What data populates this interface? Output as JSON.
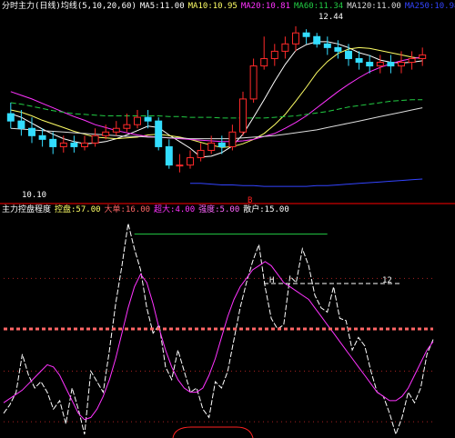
{
  "colors": {
    "background": "#000000",
    "divider": "#ff0000",
    "up_candle": "#ff2a2a",
    "down_candle": "#33ddff",
    "ma_white": "#ffffff",
    "ma_yellow": "#ffff66",
    "ma_magenta": "#ff33ff",
    "ma_green": "#22cc44",
    "ma_blue": "#3344ff",
    "dashed_red": "#ff6666"
  },
  "top_panel": {
    "header": [
      {
        "text": "分时主力(日线)均线(5,10,20,60)",
        "color": "#ffffff"
      },
      {
        "text": "MA5:11.00",
        "color": "#ffffff"
      },
      {
        "text": "MA10:10.95",
        "color": "#ffff66"
      },
      {
        "text": "MA20:10.81",
        "color": "#ff33ff"
      },
      {
        "text": "MA60:11.34",
        "color": "#22cc44"
      },
      {
        "text": "MA120:11.00",
        "color": "#dddddd"
      },
      {
        "text": "MA250:10.98",
        "color": "#3344ff"
      }
    ],
    "high_label": "12.44",
    "low_label": "10.10",
    "red_marker": "B"
  },
  "bottom_panel": {
    "header": [
      {
        "text": "主力控盘程度",
        "color": "#ffffff"
      },
      {
        "text": "控盘:57.00",
        "color": "#ffff66"
      },
      {
        "text": "大单:16.00",
        "color": "#ff6666"
      },
      {
        "text": "超大:4.00",
        "color": "#ff33ff"
      },
      {
        "text": "强度:5.00",
        "color": "#ff66ff"
      },
      {
        "text": "散户:15.00",
        "color": "#ffffff"
      }
    ],
    "marker_12": "12",
    "marker_h": "H"
  },
  "chart_data": [
    {
      "type": "candlestick",
      "note": "price panel with moving averages",
      "x": [
        1,
        2,
        3,
        4,
        5,
        6,
        7,
        8,
        9,
        10,
        11,
        12,
        13,
        14,
        15,
        16,
        17,
        18,
        19,
        20,
        21,
        22,
        23,
        24,
        25,
        26,
        27,
        28,
        29,
        30,
        31,
        32,
        33,
        34,
        35,
        36,
        37,
        38,
        39,
        40
      ],
      "open": [
        11.25,
        11.15,
        11.05,
        10.95,
        10.9,
        10.8,
        10.85,
        10.8,
        10.85,
        10.95,
        11.0,
        11.05,
        11.1,
        11.2,
        11.15,
        10.8,
        10.55,
        10.55,
        10.65,
        10.75,
        10.85,
        10.8,
        11.0,
        11.45,
        11.9,
        12.0,
        12.1,
        12.2,
        12.35,
        12.3,
        12.2,
        12.15,
        12.1,
        12.0,
        11.95,
        11.9,
        11.95,
        11.9,
        11.95,
        12.0
      ],
      "close": [
        11.15,
        11.05,
        10.95,
        10.9,
        10.8,
        10.85,
        10.8,
        10.85,
        10.95,
        11.0,
        11.05,
        11.1,
        11.2,
        11.15,
        10.8,
        10.55,
        10.55,
        10.65,
        10.75,
        10.85,
        10.8,
        11.0,
        11.45,
        11.9,
        12.0,
        12.1,
        12.2,
        12.35,
        12.3,
        12.2,
        12.15,
        12.1,
        12.0,
        11.95,
        11.9,
        11.95,
        11.9,
        11.95,
        12.0,
        12.05
      ],
      "high": [
        11.4,
        11.3,
        11.2,
        11.05,
        11.0,
        10.95,
        10.95,
        10.95,
        11.05,
        11.1,
        11.15,
        11.25,
        11.3,
        11.3,
        11.2,
        10.9,
        10.7,
        10.75,
        10.85,
        10.95,
        10.95,
        11.1,
        11.55,
        12.0,
        12.3,
        12.2,
        12.3,
        12.44,
        12.4,
        12.35,
        12.3,
        12.25,
        12.2,
        12.1,
        12.05,
        12.05,
        12.05,
        12.1,
        12.1,
        12.15
      ],
      "low": [
        11.05,
        10.95,
        10.85,
        10.8,
        10.7,
        10.72,
        10.72,
        10.75,
        10.8,
        10.9,
        10.95,
        11.0,
        11.05,
        11.05,
        10.75,
        10.5,
        10.45,
        10.5,
        10.6,
        10.7,
        10.7,
        10.75,
        10.95,
        11.4,
        11.85,
        11.9,
        12.0,
        12.1,
        12.2,
        12.15,
        12.05,
        12.0,
        11.9,
        11.85,
        11.8,
        11.8,
        11.8,
        11.8,
        11.85,
        11.9
      ],
      "ylim": [
        10.1,
        12.6
      ],
      "series": [
        {
          "name": "MA5",
          "color": "#ffffff",
          "values": [
            11.25,
            11.2,
            11.12,
            11.04,
            10.97,
            10.91,
            10.87,
            10.84,
            10.85,
            10.87,
            10.91,
            10.96,
            11.02,
            11.08,
            11.06,
            10.96,
            10.87,
            10.78,
            10.66,
            10.67,
            10.72,
            10.81,
            10.97,
            11.2,
            11.44,
            11.69,
            11.92,
            12.11,
            12.19,
            12.23,
            12.23,
            12.2,
            12.15,
            12.08,
            12.04,
            11.98,
            11.95,
            11.94,
            11.95,
            11.97
          ]
        },
        {
          "name": "MA10",
          "color": "#ffff66",
          "values": [
            11.3,
            11.27,
            11.22,
            11.16,
            11.11,
            11.06,
            11.01,
            10.97,
            10.93,
            10.92,
            10.91,
            10.92,
            10.93,
            10.96,
            10.97,
            10.95,
            10.93,
            10.9,
            10.86,
            10.82,
            10.79,
            10.8,
            10.84,
            10.9,
            10.98,
            11.1,
            11.24,
            11.42,
            11.61,
            11.81,
            11.96,
            12.07,
            12.13,
            12.15,
            12.14,
            12.11,
            12.08,
            12.05,
            12.02,
            12.0
          ]
        },
        {
          "name": "MA20",
          "color": "#ff33ff",
          "values": [
            11.55,
            11.5,
            11.45,
            11.39,
            11.33,
            11.27,
            11.21,
            11.16,
            11.1,
            11.06,
            11.02,
            10.99,
            10.96,
            10.94,
            10.93,
            10.92,
            10.91,
            10.9,
            10.89,
            10.88,
            10.87,
            10.87,
            10.88,
            10.9,
            10.94,
            10.98,
            11.05,
            11.13,
            11.22,
            11.33,
            11.44,
            11.55,
            11.65,
            11.74,
            11.82,
            11.88,
            11.93,
            11.97,
            12.0,
            12.02
          ]
        },
        {
          "name": "MA60",
          "color": "#22cc44",
          "values": [
            11.4,
            11.38,
            11.35,
            11.32,
            11.29,
            11.27,
            11.25,
            11.24,
            11.23,
            11.22,
            11.22,
            11.22,
            11.22,
            11.22,
            11.22,
            11.21,
            11.21,
            11.2,
            11.2,
            11.2,
            11.19,
            11.19,
            11.19,
            11.19,
            11.19,
            11.2,
            11.21,
            11.22,
            11.24,
            11.26,
            11.28,
            11.31,
            11.34,
            11.36,
            11.38,
            11.4,
            11.42,
            11.43,
            11.44,
            11.44
          ]
        },
        {
          "name": "MA120",
          "color": "#dddddd",
          "values": [
            11.05,
            11.04,
            11.03,
            11.02,
            11.01,
            11.0,
            10.99,
            10.98,
            10.97,
            10.96,
            10.95,
            10.94,
            10.94,
            10.93,
            10.93,
            10.92,
            10.92,
            10.91,
            10.91,
            10.91,
            10.91,
            10.91,
            10.92,
            10.93,
            10.94,
            10.95,
            10.97,
            10.99,
            11.01,
            11.03,
            11.06,
            11.09,
            11.12,
            11.15,
            11.18,
            11.21,
            11.24,
            11.27,
            11.3,
            11.33
          ]
        },
        {
          "name": "MA250",
          "color": "#3344ff",
          "values": [
            null,
            null,
            null,
            null,
            null,
            null,
            null,
            null,
            null,
            null,
            null,
            null,
            null,
            null,
            null,
            null,
            null,
            10.3,
            10.3,
            10.29,
            10.28,
            10.28,
            10.27,
            10.27,
            10.26,
            10.26,
            10.26,
            10.26,
            10.26,
            10.27,
            10.27,
            10.28,
            10.29,
            10.3,
            10.31,
            10.32,
            10.33,
            10.34,
            10.35,
            10.36
          ]
        }
      ]
    },
    {
      "type": "line",
      "note": "indicator panel",
      "x": [
        1,
        2,
        3,
        4,
        5,
        6,
        7,
        8,
        9,
        10,
        11,
        12,
        13,
        14,
        15,
        16,
        17,
        18,
        19,
        20,
        21,
        22,
        23,
        24,
        25,
        26,
        27,
        28,
        29,
        30,
        31,
        32,
        33,
        34,
        35,
        36,
        37,
        38,
        39,
        40,
        41,
        42,
        43,
        44,
        45,
        46,
        47,
        48,
        49,
        50,
        51,
        52,
        53,
        54,
        55,
        56,
        57,
        58,
        59,
        60,
        61,
        62,
        63,
        64,
        65,
        66,
        67,
        68,
        69,
        70
      ],
      "ylim": [
        0,
        100
      ],
      "series": [
        {
          "name": "white",
          "color": "#ffffff",
          "values": [
            10,
            14,
            20,
            38,
            28,
            22,
            25,
            20,
            12,
            16,
            5,
            22,
            12,
            0,
            30,
            25,
            20,
            40,
            62,
            80,
            100,
            88,
            78,
            60,
            48,
            52,
            32,
            26,
            40,
            30,
            20,
            22,
            12,
            8,
            25,
            22,
            30,
            45,
            60,
            72,
            82,
            90,
            70,
            55,
            50,
            52,
            75,
            72,
            88,
            80,
            66,
            60,
            58,
            70,
            55,
            54,
            40,
            46,
            42,
            30,
            20,
            18,
            10,
            0,
            8,
            20,
            15,
            22,
            38,
            45
          ]
        },
        {
          "name": "magenta",
          "color": "#ff33ff",
          "values": [
            15,
            17,
            19,
            21,
            24,
            27,
            30,
            33,
            32,
            28,
            22,
            16,
            10,
            7,
            8,
            12,
            18,
            26,
            36,
            48,
            60,
            70,
            76,
            72,
            62,
            50,
            40,
            32,
            26,
            22,
            20,
            20,
            22,
            28,
            36,
            46,
            56,
            64,
            70,
            74,
            78,
            80,
            82,
            80,
            76,
            72,
            70,
            68,
            66,
            64,
            60,
            56,
            52,
            48,
            44,
            40,
            36,
            32,
            28,
            24,
            20,
            18,
            16,
            16,
            18,
            22,
            28,
            34,
            40,
            44
          ]
        },
        {
          "name": "dashed-red",
          "color": "#ff6666",
          "values": [
            50,
            50,
            50,
            50,
            50,
            50,
            50,
            50,
            50,
            50,
            50,
            50,
            50,
            50,
            50,
            50,
            50,
            50,
            50,
            50,
            50,
            50,
            50,
            50,
            50,
            50,
            50,
            50,
            50,
            50,
            50,
            50,
            50,
            50,
            50,
            50,
            50,
            50,
            50,
            50,
            50,
            50,
            50,
            50,
            50,
            50,
            50,
            50,
            50,
            50,
            50,
            50,
            50,
            50,
            50,
            50,
            50,
            50,
            50,
            50,
            50,
            50,
            50,
            50,
            50,
            50,
            50,
            50,
            50,
            50
          ]
        },
        {
          "name": "green-step",
          "color": "#22cc44",
          "values": [
            null,
            null,
            null,
            null,
            null,
            null,
            null,
            null,
            null,
            null,
            null,
            null,
            null,
            null,
            null,
            null,
            null,
            null,
            null,
            null,
            null,
            95,
            95,
            95,
            95,
            95,
            95,
            95,
            95,
            95,
            95,
            95,
            95,
            95,
            95,
            95,
            95,
            95,
            95,
            95,
            95,
            95,
            95,
            95,
            95,
            95,
            95,
            95,
            95,
            95,
            95,
            95,
            95,
            null,
            null,
            null,
            null,
            null,
            null,
            null,
            null,
            null,
            null,
            null,
            null,
            null,
            null,
            null,
            null,
            null
          ]
        }
      ]
    }
  ]
}
